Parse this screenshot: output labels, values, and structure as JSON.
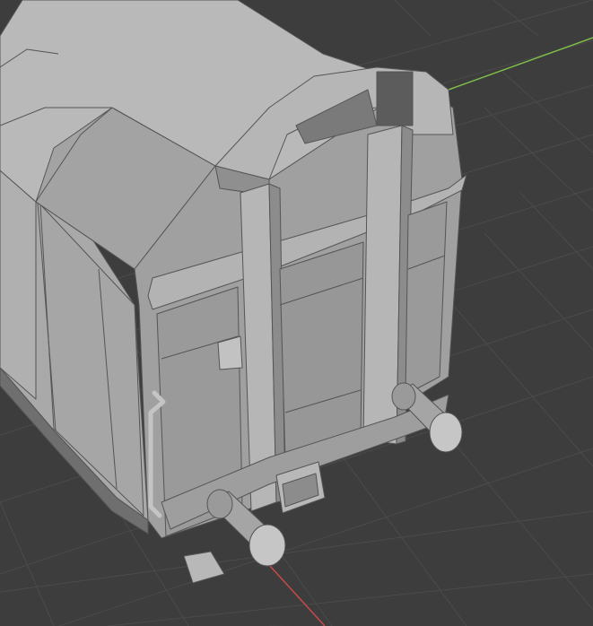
{
  "app": {
    "name": "3D Viewport"
  },
  "scene": {
    "object": "freight-wagon-model",
    "axes": {
      "x_axis_color": "#c84a4a",
      "y_axis_color": "#7fc24a"
    },
    "colors": {
      "background": "#3d3d3d",
      "grid_line": "#4b4b4b",
      "model_light": "#b9b9b9",
      "model_mid": "#a3a3a3",
      "model_dark": "#8c8c8c",
      "model_shadow": "#6f6f6f",
      "edge": "#555555"
    }
  }
}
